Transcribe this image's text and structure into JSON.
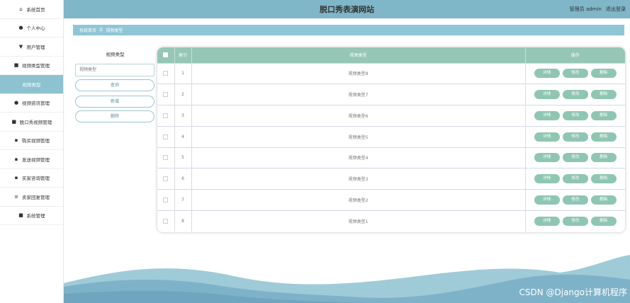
{
  "header": {
    "title": "脱口秀表演网站",
    "user_label": "管理员 admin",
    "logout": "退出登录"
  },
  "sidebar": {
    "items": [
      {
        "label": "系统首页",
        "icon": "home-icon",
        "glyph": "⌂",
        "active": false
      },
      {
        "label": "个人中心",
        "icon": "person-icon",
        "glyph": "●",
        "active": false
      },
      {
        "label": "用户管理",
        "icon": "pin-icon",
        "glyph": "▼",
        "active": false
      },
      {
        "label": "视频类型管理",
        "icon": "video-icon",
        "glyph": "■",
        "active": false
      },
      {
        "label": "视频类型",
        "icon": "",
        "glyph": "",
        "active": true
      },
      {
        "label": "视频资讯管理",
        "icon": "person-icon",
        "glyph": "●",
        "active": false
      },
      {
        "label": "脱口秀视频管理",
        "icon": "clipboard-icon",
        "glyph": "■",
        "active": false
      },
      {
        "label": "购买视频管理",
        "icon": "grid-icon",
        "glyph": "▪",
        "active": false
      },
      {
        "label": "发送视频管理",
        "icon": "grid-icon",
        "glyph": "▪",
        "active": false
      },
      {
        "label": "买家咨询管理",
        "icon": "grid-icon",
        "glyph": "▪",
        "active": false
      },
      {
        "label": "卖家回复管理",
        "icon": "list-icon",
        "glyph": "≡",
        "active": false
      },
      {
        "label": "系统管理",
        "icon": "clipboard-icon",
        "glyph": "■",
        "active": false
      }
    ]
  },
  "breadcrumb": {
    "home": "系统首页",
    "separator": "☰",
    "current": "视频类型"
  },
  "search": {
    "label": "视频类型",
    "placeholder": "视频类型",
    "query_button": "查询",
    "add_button": "新增",
    "delete_button": "删除"
  },
  "table": {
    "headers": {
      "index": "索引",
      "type": "视频类型",
      "ops": "操作"
    },
    "ops": {
      "detail": "详情",
      "edit": "修改",
      "delete": "删除"
    },
    "rows": [
      {
        "index": "1",
        "type": "视频类型8"
      },
      {
        "index": "2",
        "type": "视频类型7"
      },
      {
        "index": "3",
        "type": "视频类型6"
      },
      {
        "index": "4",
        "type": "视频类型5"
      },
      {
        "index": "5",
        "type": "视频类型4"
      },
      {
        "index": "6",
        "type": "视频类型3"
      },
      {
        "index": "7",
        "type": "视频类型2"
      },
      {
        "index": "8",
        "type": "视频类型1"
      }
    ]
  },
  "watermark": "CSDN @Django计算机程序",
  "colors": {
    "header": "#7fb6c8",
    "breadcrumb": "#8fc6d5",
    "sidebar_active": "#8dc2d0",
    "table_header": "#96c6b6",
    "op_button": "#8fc6b2",
    "wave_light": "#9fcbd8",
    "wave_dark": "#6fa5bf"
  }
}
